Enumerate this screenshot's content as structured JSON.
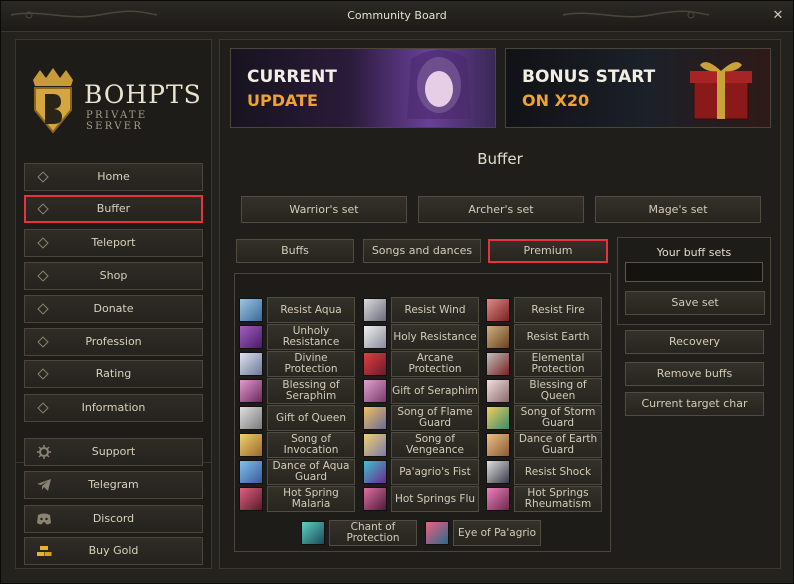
{
  "window": {
    "title": "Community Board",
    "close_glyph": "✕"
  },
  "logo": {
    "main": "BOHPTS",
    "sub": "PRIVATE SERVER"
  },
  "nav": [
    {
      "label": "Home",
      "icon": "diamond-icon"
    },
    {
      "label": "Buffer",
      "icon": "diamond-icon",
      "selected": true
    },
    {
      "label": "Teleport",
      "icon": "diamond-icon"
    },
    {
      "label": "Shop",
      "icon": "diamond-icon"
    },
    {
      "label": "Donate",
      "icon": "diamond-icon"
    },
    {
      "label": "Profession",
      "icon": "diamond-icon"
    },
    {
      "label": "Rating",
      "icon": "diamond-icon"
    },
    {
      "label": "Information",
      "icon": "diamond-icon"
    }
  ],
  "links": [
    {
      "label": "Support",
      "icon": "gear-icon"
    },
    {
      "label": "Telegram",
      "icon": "telegram-icon"
    },
    {
      "label": "Discord",
      "icon": "discord-icon"
    },
    {
      "label": "Buy Gold",
      "icon": "gold-icon"
    }
  ],
  "banners": [
    {
      "line1": "CURRENT",
      "line2": "UPDATE"
    },
    {
      "line1": "BONUS START",
      "line2": "ON X20"
    }
  ],
  "section_title": "Buffer",
  "sets": [
    "Warrior's set",
    "Archer's set",
    "Mage's set"
  ],
  "tabs": [
    "Buffs",
    "Songs and dances",
    "Premium"
  ],
  "selected_tab": "Premium",
  "buffs": [
    "Resist Aqua",
    "Resist Wind",
    "Resist Fire",
    "Unholy Resistance",
    "Holy Resistance",
    "Resist Earth",
    "Divine Protection",
    "Arcane Protection",
    "Elemental Protection",
    "Blessing of Seraphim",
    "Gift of Seraphim",
    "Blessing of Queen",
    "Gift of Queen",
    "Song of Flame Guard",
    "Song of Storm Guard",
    "Song of Invocation",
    "Song of Vengeance",
    "Dance of Earth Guard",
    "Dance of Aqua Guard",
    "Pa'agrio's Fist",
    "Resist Shock",
    "Hot Spring Malaria",
    "Hot Springs Flu",
    "Hot Springs Rheumatism",
    "Chant of Protection",
    "Eye of Pa'agrio"
  ],
  "buff_sets": {
    "title": "Your buff sets",
    "input_value": "",
    "save_label": "Save set"
  },
  "actions": [
    "Recovery",
    "Remove buffs",
    "Current target char"
  ],
  "colors": {
    "highlight": "#e5343b",
    "accent_orange": "#f0a230"
  }
}
